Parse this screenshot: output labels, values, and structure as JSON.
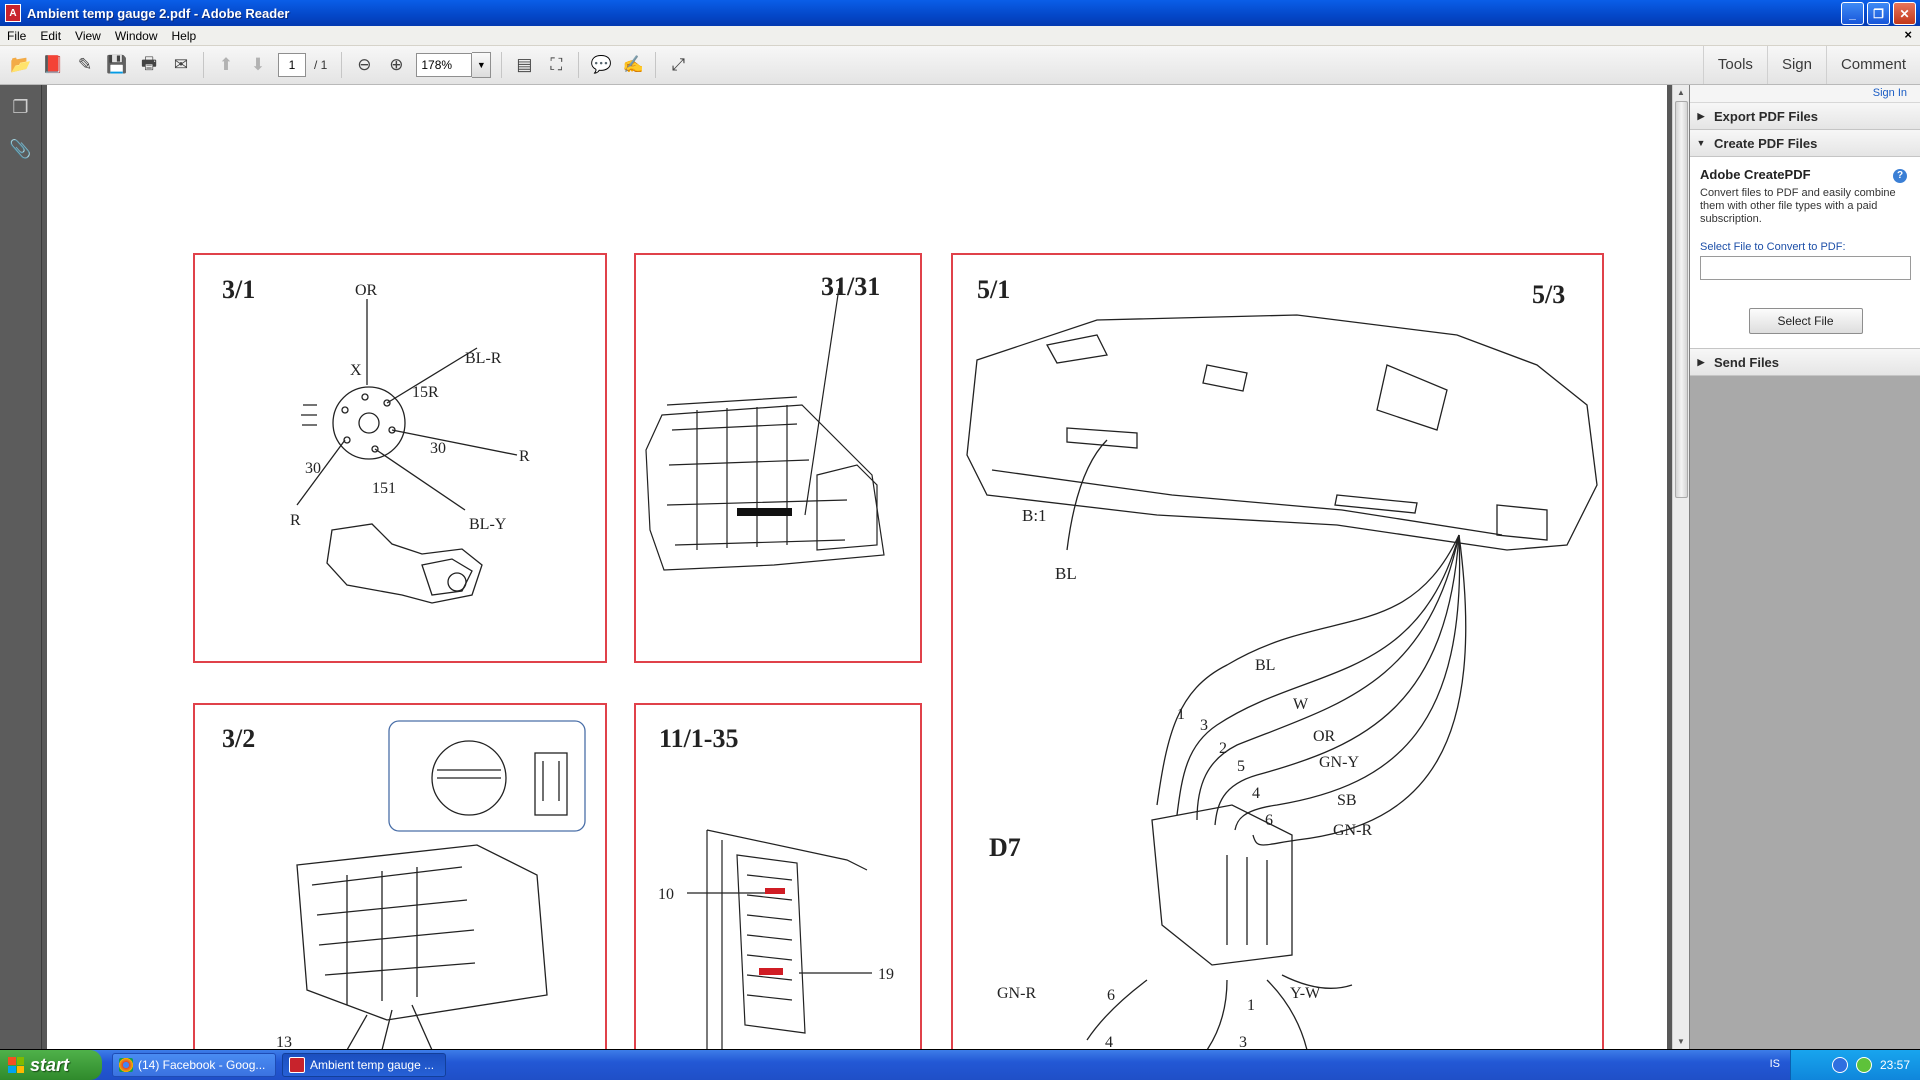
{
  "window": {
    "title": "Ambient temp gauge 2.pdf - Adobe Reader",
    "app_icon_letter": "A"
  },
  "menu": {
    "items": [
      "File",
      "Edit",
      "View",
      "Window",
      "Help"
    ],
    "close_symbol": "×"
  },
  "toolbar": {
    "page_current": "1",
    "page_total": "/ 1",
    "zoom": "178%"
  },
  "top_links": {
    "tools": "Tools",
    "sign": "Sign",
    "comment": "Comment"
  },
  "right_pane": {
    "sign_in": "Sign In",
    "export_label": "Export PDF Files",
    "create_label": "Create PDF Files",
    "create_title": "Adobe CreatePDF",
    "create_help": "?",
    "create_desc": "Convert files to PDF and easily combine them with other file types with a paid subscription.",
    "select_label": "Select File to Convert to PDF:",
    "select_button": "Select File",
    "send_label": "Send Files"
  },
  "diagram": {
    "panel_3_1": {
      "title": "3/1",
      "labels": [
        "OR",
        "X",
        "BL-R",
        "15R",
        "30",
        "R",
        "30",
        "151",
        "R",
        "BL-Y"
      ]
    },
    "panel_31_31": {
      "title": "31/31"
    },
    "panel_5_1": {
      "title": "5/1",
      "title_right": "5/3",
      "connector": "B:1",
      "connector_wire": "BL",
      "d7": "D7",
      "wires": [
        "BL",
        "W",
        "OR",
        "GN-Y",
        "SB",
        "GN-R"
      ],
      "pins": [
        "1",
        "3",
        "2",
        "5",
        "4",
        "6"
      ],
      "bottom_labels": [
        "GN-R",
        "6",
        "1",
        "Y-W",
        "4",
        "3"
      ]
    },
    "panel_3_2": {
      "title": "3/2",
      "bottom_num": "13"
    },
    "panel_11_1_35": {
      "title": "11/1-35",
      "num_left": "10",
      "num_right": "19"
    }
  },
  "taskbar": {
    "start": "start",
    "tasks": [
      {
        "label": "(14) Facebook - Goog...",
        "active": false
      },
      {
        "label": "Ambient temp gauge ...",
        "active": true
      }
    ],
    "lang": "IS",
    "clock": "23:57"
  },
  "colors": {
    "panel_border": "#e0414a",
    "titlebar": "#0a5ee8",
    "taskbar": "#2358d5",
    "start": "#3a9a36"
  }
}
